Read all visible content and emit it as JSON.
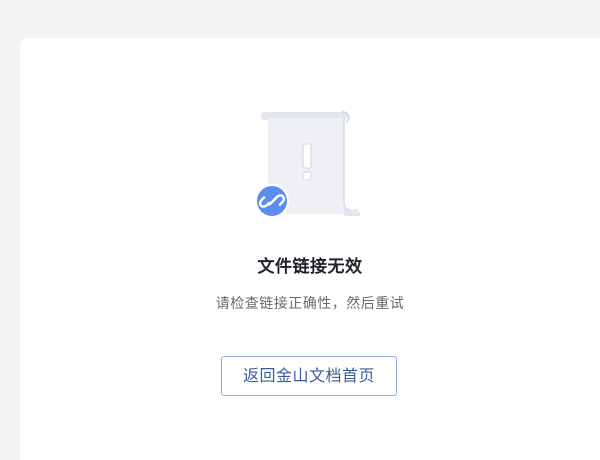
{
  "error": {
    "title": "文件链接无效",
    "message": "请检查链接正确性，然后重试",
    "icon": "broken-link-document-icon"
  },
  "actions": {
    "back_label": "返回金山文档首页"
  },
  "colors": {
    "page_background": "#f3f3f4",
    "card_background": "#ffffff",
    "title": "#1f2329",
    "message": "#646a73",
    "button_border": "#8fa9d6",
    "button_text": "#3b5d99",
    "link_badge": "#5b8def"
  }
}
